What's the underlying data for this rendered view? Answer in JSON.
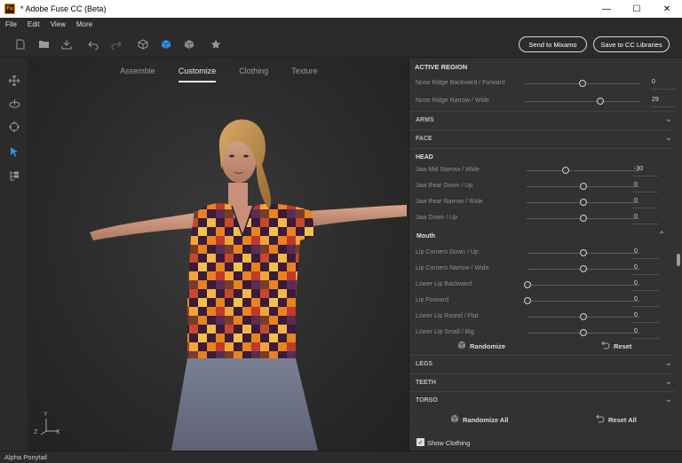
{
  "window": {
    "app_icon": "Fu",
    "title": "* Adobe Fuse CC (Beta)",
    "minimize": "—",
    "maximize": "☐",
    "close": "✕"
  },
  "menu": [
    "File",
    "Edit",
    "View",
    "More"
  ],
  "toolbar": {
    "icons": [
      "new-file-icon",
      "open-folder-icon",
      "import-icon",
      "undo-icon",
      "redo-icon",
      "cube-outline-icon",
      "cube-solid-icon",
      "cube-shaded-icon",
      "star-icon"
    ],
    "send_to_mixamo": "Send to Mixamo",
    "save_to_cc": "Save to CC Libraries"
  },
  "left_rail": [
    "orbit-icon",
    "rotate-icon",
    "focus-target-icon",
    "select-arrow-icon",
    "hierarchy-icon"
  ],
  "tabs": [
    "Assemble",
    "Customize",
    "Clothing",
    "Texture"
  ],
  "active_tab": "Customize",
  "axes": {
    "y": "Y",
    "z": "Z",
    "x": "X"
  },
  "panel": {
    "active_region_title": "ACTIVE REGION",
    "active_region_rows": [
      {
        "label": "Nose Ridge Backward / Forward",
        "value": "0",
        "pos": 0.5
      },
      {
        "label": "Nose Ridge Narrow / Wide",
        "value": "29",
        "pos": 0.65
      }
    ],
    "collapsed_top": [
      "ARMS",
      "FACE"
    ],
    "head_title": "HEAD",
    "head_rows": [
      {
        "label": "Jaw Mid Narrow / Wide",
        "value": "-30",
        "pos": 0.35
      },
      {
        "label": "Jaw Rear Down / Up",
        "value": "0",
        "pos": 0.5
      },
      {
        "label": "Jaw Rear Narrow / Wide",
        "value": "0",
        "pos": 0.5
      },
      {
        "label": "Jaw Down / Up",
        "value": "0",
        "pos": 0.5
      }
    ],
    "mouth_title": "Mouth",
    "mouth_rows": [
      {
        "label": "Lip Corners Down / Up",
        "value": "0",
        "pos": 0.5
      },
      {
        "label": "Lip Corners Narrow / Wide",
        "value": "0",
        "pos": 0.5
      },
      {
        "label": "Lower Lip Backward",
        "value": "0",
        "pos": 0.0
      },
      {
        "label": "Lip Forward",
        "value": "0",
        "pos": 0.0
      },
      {
        "label": "Lower Lip Round / Flat",
        "value": "0",
        "pos": 0.5
      },
      {
        "label": "Lower Lip Small / Big",
        "value": "0",
        "pos": 0.5
      }
    ],
    "randomize": "Randomize",
    "reset": "Reset",
    "collapsed_bottom": [
      "LEGS",
      "TEETH",
      "TORSO"
    ],
    "randomize_all": "Randomize All",
    "reset_all": "Reset All",
    "show_clothing": "Show Clothing",
    "show_clothing_checked": "✓"
  },
  "status": "Alpha Ponytail"
}
